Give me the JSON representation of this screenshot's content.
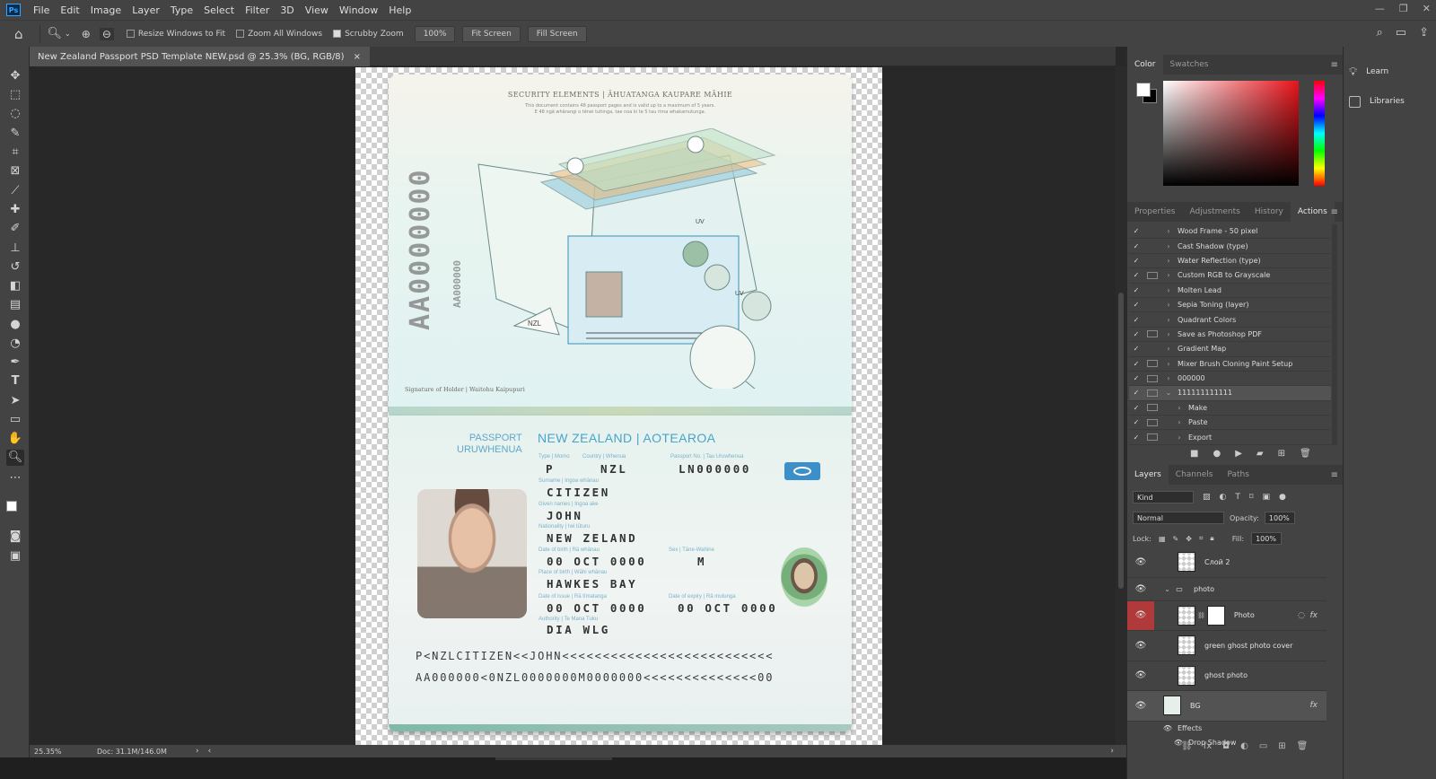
{
  "menubar": {
    "app_icon": "Ps",
    "items": [
      "File",
      "Edit",
      "Image",
      "Layer",
      "Type",
      "Select",
      "Filter",
      "3D",
      "View",
      "Window",
      "Help"
    ]
  },
  "options_bar": {
    "resize_windows": "Resize Windows to Fit",
    "zoom_all": "Zoom All Windows",
    "scrubby_zoom": "Scrubby Zoom",
    "zoom_value": "100%",
    "fit_screen": "Fit Screen",
    "fill_screen": "Fill Screen"
  },
  "document": {
    "tab_title": "New Zealand Passport PSD Template NEW.psd @ 25.3% (BG, RGB/8)",
    "close": "×"
  },
  "status": {
    "zoom": "25.35%",
    "doc_size": "Doc: 31.1M/146.0M"
  },
  "passport": {
    "security_title": "SECURITY ELEMENTS | ĀHUATANGA KAUPARE MĀHIE",
    "security_sub1": "This document contains 48 passport pages and is valid up to a maximum of 5 years.",
    "security_sub2": "E 48 ngā whārangi o tēnei tuhinga, tae noa ki te 5 tau rima whakamutunga.",
    "vertical_number": "AA0000000",
    "vertical_small": "AA000000",
    "signature_label": "Signature of Holder | Waitohu Kaipupuri",
    "heading_left_1": "PASSPORT",
    "heading_left_2": "URUWHENUA",
    "heading_main": "NEW ZEALAND | AOTEAROA",
    "type_label": "Type | Momo",
    "type_value": "P",
    "country_label": "Country | Whenua",
    "country_value": "NZL",
    "passport_no_label": "Passport No. | Tau Uruwhenua",
    "passport_no_value": "LN000000",
    "surname_label": "Surname | Ingoa whānau",
    "surname_value": "CITIZEN",
    "given_label": "Given names | Ingoa ake",
    "given_value": "JOHN",
    "nationality_label": "Nationality | Iwi tūturu",
    "nationality_value": "NEW ZELAND",
    "dob_label": "Date of birth | Rā whānau",
    "dob_value": "00 OCT 0000",
    "sex_label": "Sex | Tāne-Wahine",
    "sex_value": "M",
    "pob_label": "Place of birth | Wāhi whānau",
    "pob_value": "HAWKES BAY",
    "doi_label": "Date of issue | Rā tīmatanga",
    "doi_value": "00 OCT 0000",
    "doe_label": "Date of expiry | Rā mutunga",
    "doe_value": "00 OCT 0000",
    "authority_label": "Authority | Te Mana Tuku",
    "authority_value": "DIA WLG",
    "mrz_line1": "P<NZLCITIZEN<<JOHN<<<<<<<<<<<<<<<<<<<<<<<<<<",
    "mrz_line2": "AA000000<0NZL0000000M0000000<<<<<<<<<<<<<<00",
    "uv_label_1": "UV",
    "uv_label_2": "UV",
    "illus_label": "NZL"
  },
  "color_panel": {
    "tabs": [
      "Color",
      "Swatches"
    ],
    "active_tab": "Color"
  },
  "actions_panel": {
    "tabs": [
      "Properties",
      "Adjustments",
      "History",
      "Actions"
    ],
    "active_tab": "Actions",
    "items": [
      {
        "label": "Wood Frame - 50 pixel",
        "dialog": false,
        "expanded": false,
        "indent": 0
      },
      {
        "label": "Cast Shadow (type)",
        "dialog": false,
        "expanded": false,
        "indent": 0
      },
      {
        "label": "Water Reflection (type)",
        "dialog": false,
        "expanded": false,
        "indent": 0
      },
      {
        "label": "Custom RGB to Grayscale",
        "dialog": true,
        "expanded": false,
        "indent": 0
      },
      {
        "label": "Molten Lead",
        "dialog": false,
        "expanded": false,
        "indent": 0
      },
      {
        "label": "Sepia Toning (layer)",
        "dialog": false,
        "expanded": false,
        "indent": 0
      },
      {
        "label": "Quadrant Colors",
        "dialog": false,
        "expanded": false,
        "indent": 0
      },
      {
        "label": "Save as Photoshop PDF",
        "dialog": true,
        "expanded": false,
        "indent": 0
      },
      {
        "label": "Gradient Map",
        "dialog": false,
        "expanded": false,
        "indent": 0
      },
      {
        "label": "Mixer Brush Cloning Paint Setup",
        "dialog": true,
        "expanded": false,
        "indent": 0
      },
      {
        "label": "000000",
        "dialog": true,
        "expanded": false,
        "indent": 0
      },
      {
        "label": "111111111111",
        "dialog": true,
        "expanded": true,
        "indent": 0,
        "selected": true
      },
      {
        "label": "Make",
        "dialog": true,
        "expanded": false,
        "indent": 1
      },
      {
        "label": "Paste",
        "dialog": true,
        "expanded": false,
        "indent": 1
      },
      {
        "label": "Export",
        "dialog": true,
        "expanded": false,
        "indent": 1
      }
    ]
  },
  "layers_panel": {
    "tabs": [
      "Layers",
      "Channels",
      "Paths"
    ],
    "active_tab": "Layers",
    "filter_kind": "Kind",
    "blend_mode": "Normal",
    "opacity_label": "Opacity:",
    "opacity_value": "100%",
    "lock_label": "Lock:",
    "fill_label": "Fill:",
    "fill_value": "100%",
    "layers": [
      {
        "name": "Слой 2",
        "kind": "layer"
      },
      {
        "name": "photo",
        "kind": "group"
      },
      {
        "name": "Photo",
        "kind": "smart",
        "selected_eye": true,
        "fx": true
      },
      {
        "name": "green ghost photo cover",
        "kind": "layer"
      },
      {
        "name": "ghost photo",
        "kind": "smart"
      },
      {
        "name": "BG",
        "kind": "layer",
        "fx": true,
        "selected": true
      }
    ],
    "effects_label": "Effects",
    "drop_shadow_label": "Drop Shadow"
  },
  "side_panel": {
    "learn": "Learn",
    "libraries": "Libraries"
  }
}
